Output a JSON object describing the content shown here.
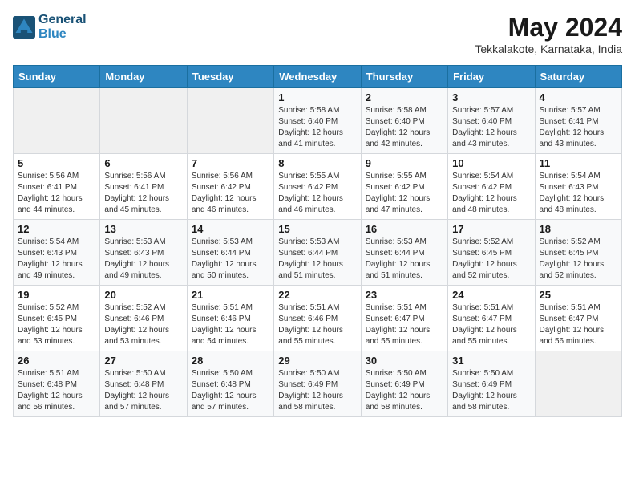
{
  "header": {
    "logo_line1": "General",
    "logo_line2": "Blue",
    "title": "May 2024",
    "location": "Tekkalakote, Karnataka, India"
  },
  "weekdays": [
    "Sunday",
    "Monday",
    "Tuesday",
    "Wednesday",
    "Thursday",
    "Friday",
    "Saturday"
  ],
  "weeks": [
    [
      {
        "day": "",
        "info": ""
      },
      {
        "day": "",
        "info": ""
      },
      {
        "day": "",
        "info": ""
      },
      {
        "day": "1",
        "info": "Sunrise: 5:58 AM\nSunset: 6:40 PM\nDaylight: 12 hours\nand 41 minutes."
      },
      {
        "day": "2",
        "info": "Sunrise: 5:58 AM\nSunset: 6:40 PM\nDaylight: 12 hours\nand 42 minutes."
      },
      {
        "day": "3",
        "info": "Sunrise: 5:57 AM\nSunset: 6:40 PM\nDaylight: 12 hours\nand 43 minutes."
      },
      {
        "day": "4",
        "info": "Sunrise: 5:57 AM\nSunset: 6:41 PM\nDaylight: 12 hours\nand 43 minutes."
      }
    ],
    [
      {
        "day": "5",
        "info": "Sunrise: 5:56 AM\nSunset: 6:41 PM\nDaylight: 12 hours\nand 44 minutes."
      },
      {
        "day": "6",
        "info": "Sunrise: 5:56 AM\nSunset: 6:41 PM\nDaylight: 12 hours\nand 45 minutes."
      },
      {
        "day": "7",
        "info": "Sunrise: 5:56 AM\nSunset: 6:42 PM\nDaylight: 12 hours\nand 46 minutes."
      },
      {
        "day": "8",
        "info": "Sunrise: 5:55 AM\nSunset: 6:42 PM\nDaylight: 12 hours\nand 46 minutes."
      },
      {
        "day": "9",
        "info": "Sunrise: 5:55 AM\nSunset: 6:42 PM\nDaylight: 12 hours\nand 47 minutes."
      },
      {
        "day": "10",
        "info": "Sunrise: 5:54 AM\nSunset: 6:42 PM\nDaylight: 12 hours\nand 48 minutes."
      },
      {
        "day": "11",
        "info": "Sunrise: 5:54 AM\nSunset: 6:43 PM\nDaylight: 12 hours\nand 48 minutes."
      }
    ],
    [
      {
        "day": "12",
        "info": "Sunrise: 5:54 AM\nSunset: 6:43 PM\nDaylight: 12 hours\nand 49 minutes."
      },
      {
        "day": "13",
        "info": "Sunrise: 5:53 AM\nSunset: 6:43 PM\nDaylight: 12 hours\nand 49 minutes."
      },
      {
        "day": "14",
        "info": "Sunrise: 5:53 AM\nSunset: 6:44 PM\nDaylight: 12 hours\nand 50 minutes."
      },
      {
        "day": "15",
        "info": "Sunrise: 5:53 AM\nSunset: 6:44 PM\nDaylight: 12 hours\nand 51 minutes."
      },
      {
        "day": "16",
        "info": "Sunrise: 5:53 AM\nSunset: 6:44 PM\nDaylight: 12 hours\nand 51 minutes."
      },
      {
        "day": "17",
        "info": "Sunrise: 5:52 AM\nSunset: 6:45 PM\nDaylight: 12 hours\nand 52 minutes."
      },
      {
        "day": "18",
        "info": "Sunrise: 5:52 AM\nSunset: 6:45 PM\nDaylight: 12 hours\nand 52 minutes."
      }
    ],
    [
      {
        "day": "19",
        "info": "Sunrise: 5:52 AM\nSunset: 6:45 PM\nDaylight: 12 hours\nand 53 minutes."
      },
      {
        "day": "20",
        "info": "Sunrise: 5:52 AM\nSunset: 6:46 PM\nDaylight: 12 hours\nand 53 minutes."
      },
      {
        "day": "21",
        "info": "Sunrise: 5:51 AM\nSunset: 6:46 PM\nDaylight: 12 hours\nand 54 minutes."
      },
      {
        "day": "22",
        "info": "Sunrise: 5:51 AM\nSunset: 6:46 PM\nDaylight: 12 hours\nand 55 minutes."
      },
      {
        "day": "23",
        "info": "Sunrise: 5:51 AM\nSunset: 6:47 PM\nDaylight: 12 hours\nand 55 minutes."
      },
      {
        "day": "24",
        "info": "Sunrise: 5:51 AM\nSunset: 6:47 PM\nDaylight: 12 hours\nand 55 minutes."
      },
      {
        "day": "25",
        "info": "Sunrise: 5:51 AM\nSunset: 6:47 PM\nDaylight: 12 hours\nand 56 minutes."
      }
    ],
    [
      {
        "day": "26",
        "info": "Sunrise: 5:51 AM\nSunset: 6:48 PM\nDaylight: 12 hours\nand 56 minutes."
      },
      {
        "day": "27",
        "info": "Sunrise: 5:50 AM\nSunset: 6:48 PM\nDaylight: 12 hours\nand 57 minutes."
      },
      {
        "day": "28",
        "info": "Sunrise: 5:50 AM\nSunset: 6:48 PM\nDaylight: 12 hours\nand 57 minutes."
      },
      {
        "day": "29",
        "info": "Sunrise: 5:50 AM\nSunset: 6:49 PM\nDaylight: 12 hours\nand 58 minutes."
      },
      {
        "day": "30",
        "info": "Sunrise: 5:50 AM\nSunset: 6:49 PM\nDaylight: 12 hours\nand 58 minutes."
      },
      {
        "day": "31",
        "info": "Sunrise: 5:50 AM\nSunset: 6:49 PM\nDaylight: 12 hours\nand 58 minutes."
      },
      {
        "day": "",
        "info": ""
      }
    ]
  ]
}
